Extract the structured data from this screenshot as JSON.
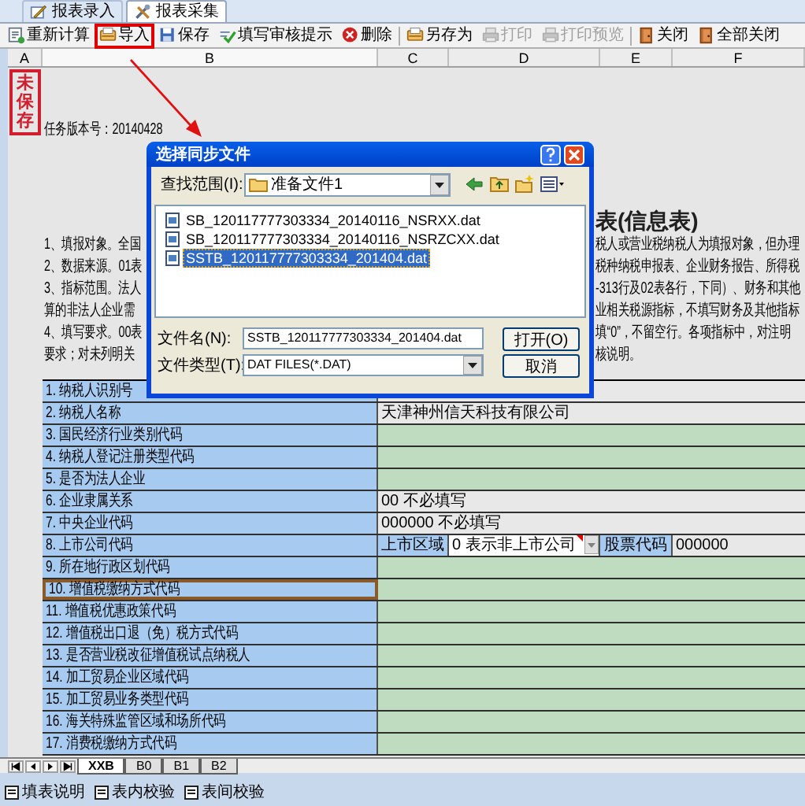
{
  "tabs": [
    {
      "label": "报表录入",
      "selected": false
    },
    {
      "label": "报表采集",
      "selected": true
    }
  ],
  "toolbar": [
    {
      "label": "重新计算",
      "disabled": false,
      "highlighted": false
    },
    {
      "label": "导入",
      "disabled": false,
      "highlighted": true
    },
    {
      "label": "保存",
      "disabled": false,
      "highlighted": false
    },
    {
      "label": "填写审核提示",
      "disabled": false,
      "highlighted": false
    },
    {
      "label": "删除",
      "disabled": false,
      "highlighted": false
    },
    {
      "label": "另存为",
      "disabled": false,
      "highlighted": false
    },
    {
      "label": "打印",
      "disabled": true,
      "highlighted": false
    },
    {
      "label": "打印预览",
      "disabled": true,
      "highlighted": false
    },
    {
      "label": "关闭",
      "disabled": false,
      "highlighted": false
    },
    {
      "label": "全部关闭",
      "disabled": false,
      "highlighted": false
    }
  ],
  "columns": [
    "A",
    "B",
    "C",
    "D",
    "E",
    "F"
  ],
  "stamp": "未保存",
  "version": "任务版本号：20140428",
  "sheet_title": "表(信息表)",
  "notes": [
    {
      "left": "1、填报对象。全国",
      "right": "税人或营业税纳税人为填报对象，但办理"
    },
    {
      "left": "2、数据来源。01表",
      "right": "税种纳税申报表、企业财务报告、所得税"
    },
    {
      "left": "3、指标范围。法人",
      "right": "-313行及02表各行，下同）、财务和其他"
    },
    {
      "left": "算的非法人企业需",
      "right": "业相关税源指标，不填写财务及其他指标"
    },
    {
      "left": "4、填写要求。00表",
      "right": "填“0”，不留空行。各项指标中，对注明"
    },
    {
      "left": "要求；对未列明关",
      "right": "核说明。"
    }
  ],
  "rows": [
    {
      "label": "1. 纳税人识别号",
      "kind": "text",
      "selected": false
    },
    {
      "label": "2. 纳税人名称",
      "kind": "text",
      "value": "天津神州信天科技有限公司",
      "selected": false
    },
    {
      "label": "3. 国民经济行业类别代码",
      "kind": "input",
      "selected": false
    },
    {
      "label": "4. 纳税人登记注册类型代码",
      "kind": "input",
      "selected": false
    },
    {
      "label": "5. 是否为法人企业",
      "kind": "input",
      "selected": false
    },
    {
      "label": "6. 企业隶属关系",
      "kind": "text",
      "value": "00 不必填写",
      "selected": false
    },
    {
      "label": "7. 中央企业代码",
      "kind": "text",
      "value": "000000 不必填写",
      "selected": false
    },
    {
      "label": "8. 上市公司代码",
      "kind": "listed",
      "region_label": "上市区域",
      "region_value": "0 表示非上市公司",
      "code_label": "股票代码",
      "code_value": "000000",
      "selected": false
    },
    {
      "label": "9. 所在地行政区划代码",
      "kind": "input",
      "selected": false
    },
    {
      "label": "10. 增值税缴纳方式代码",
      "kind": "input",
      "selected": true
    },
    {
      "label": "11. 增值税优惠政策代码",
      "kind": "input",
      "selected": false
    },
    {
      "label": "12. 增值税出口退（免）税方式代码",
      "kind": "input",
      "selected": false
    },
    {
      "label": "13. 是否营业税改征增值税试点纳税人",
      "kind": "input",
      "selected": false
    },
    {
      "label": "14. 加工贸易企业区域代码",
      "kind": "input",
      "selected": false
    },
    {
      "label": "15. 加工贸易业务类型代码",
      "kind": "input",
      "selected": false
    },
    {
      "label": "16. 海关特殊监管区域和场所代码",
      "kind": "input",
      "selected": false
    },
    {
      "label": "17. 消费税缴纳方式代码",
      "kind": "input",
      "selected": false
    }
  ],
  "sheet_tabs": [
    {
      "label": "XXB",
      "selected": true
    },
    {
      "label": "B0",
      "selected": false
    },
    {
      "label": "B1",
      "selected": false
    },
    {
      "label": "B2",
      "selected": false
    }
  ],
  "status_buttons": [
    "填表说明",
    "表内校验",
    "表间校验"
  ],
  "dialog": {
    "title": "选择同步文件",
    "look_in_label": "查找范围(I):",
    "look_in": "准备文件1",
    "files": [
      {
        "name": "SB_120117777303334_20140116_NSRXX.dat",
        "selected": false
      },
      {
        "name": "SB_120117777303334_20140116_NSRZCXX.dat",
        "selected": false
      },
      {
        "name": "SSTB_120117777303334_201404.dat",
        "selected": true
      }
    ],
    "file_name_label": "文件名(N):",
    "file_name": "SSTB_120117777303334_201404.dat",
    "file_type_label": "文件类型(T):",
    "file_type": "DAT FILES(*.DAT)",
    "open_button": "打开(O)",
    "cancel_button": "取消"
  }
}
